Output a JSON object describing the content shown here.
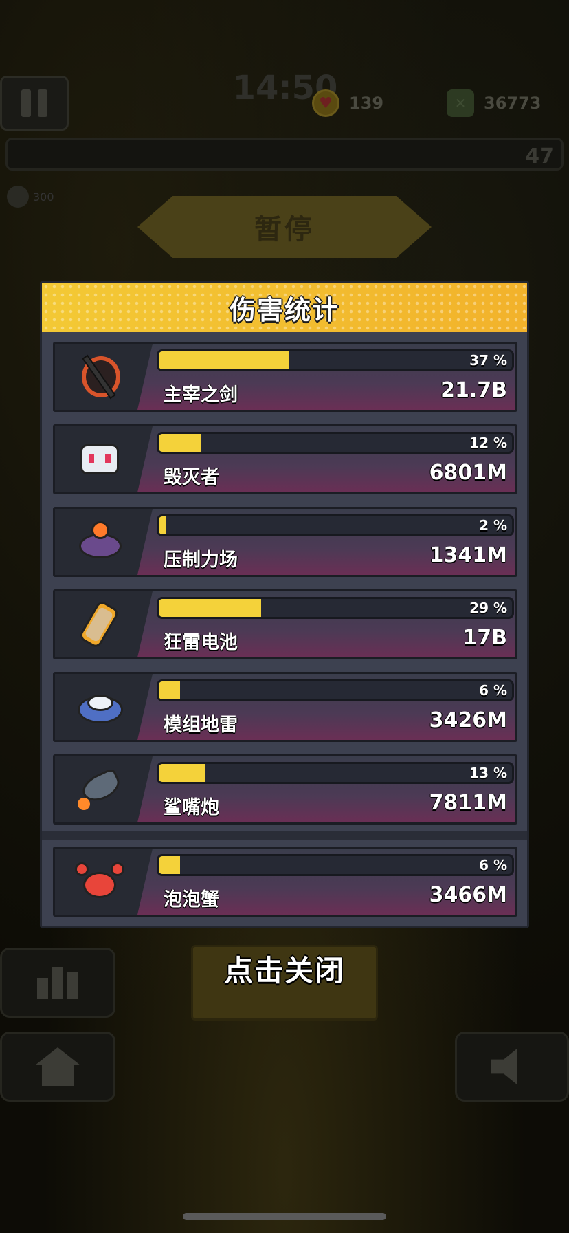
{
  "hud": {
    "timer": "14:50",
    "hearts": "139",
    "cash": "36773",
    "level": "47",
    "kills": "300"
  },
  "pause_banner": "暂停",
  "panel": {
    "title": "伤害统计",
    "weapons": [
      {
        "name": "主宰之剑",
        "percent": 37,
        "percent_label": "37 %",
        "damage": "21.7B",
        "icon": "sword-icon"
      },
      {
        "name": "毁灭者",
        "percent": 12,
        "percent_label": "12 %",
        "damage": "6801M",
        "icon": "destroyer-drone-icon"
      },
      {
        "name": "压制力场",
        "percent": 2,
        "percent_label": "2 %",
        "damage": "1341M",
        "icon": "force-field-icon"
      },
      {
        "name": "狂雷电池",
        "percent": 29,
        "percent_label": "29 %",
        "damage": "17B",
        "icon": "battery-icon"
      },
      {
        "name": "模组地雷",
        "percent": 6,
        "percent_label": "6 %",
        "damage": "3426M",
        "icon": "mine-icon"
      },
      {
        "name": "鲨嘴炮",
        "percent": 13,
        "percent_label": "13 %",
        "damage": "7811M",
        "icon": "shark-cannon-icon"
      }
    ],
    "pet": {
      "name": "泡泡蟹",
      "percent": 6,
      "percent_label": "6 %",
      "damage": "3466M",
      "icon": "crab-icon"
    }
  },
  "close_label": "点击关闭",
  "colors": {
    "header_yellow": "#f3c935",
    "bar_fill": "#f4d23a",
    "panel_bg": "#3d4150",
    "row_gradient_end": "#6a2f55"
  }
}
